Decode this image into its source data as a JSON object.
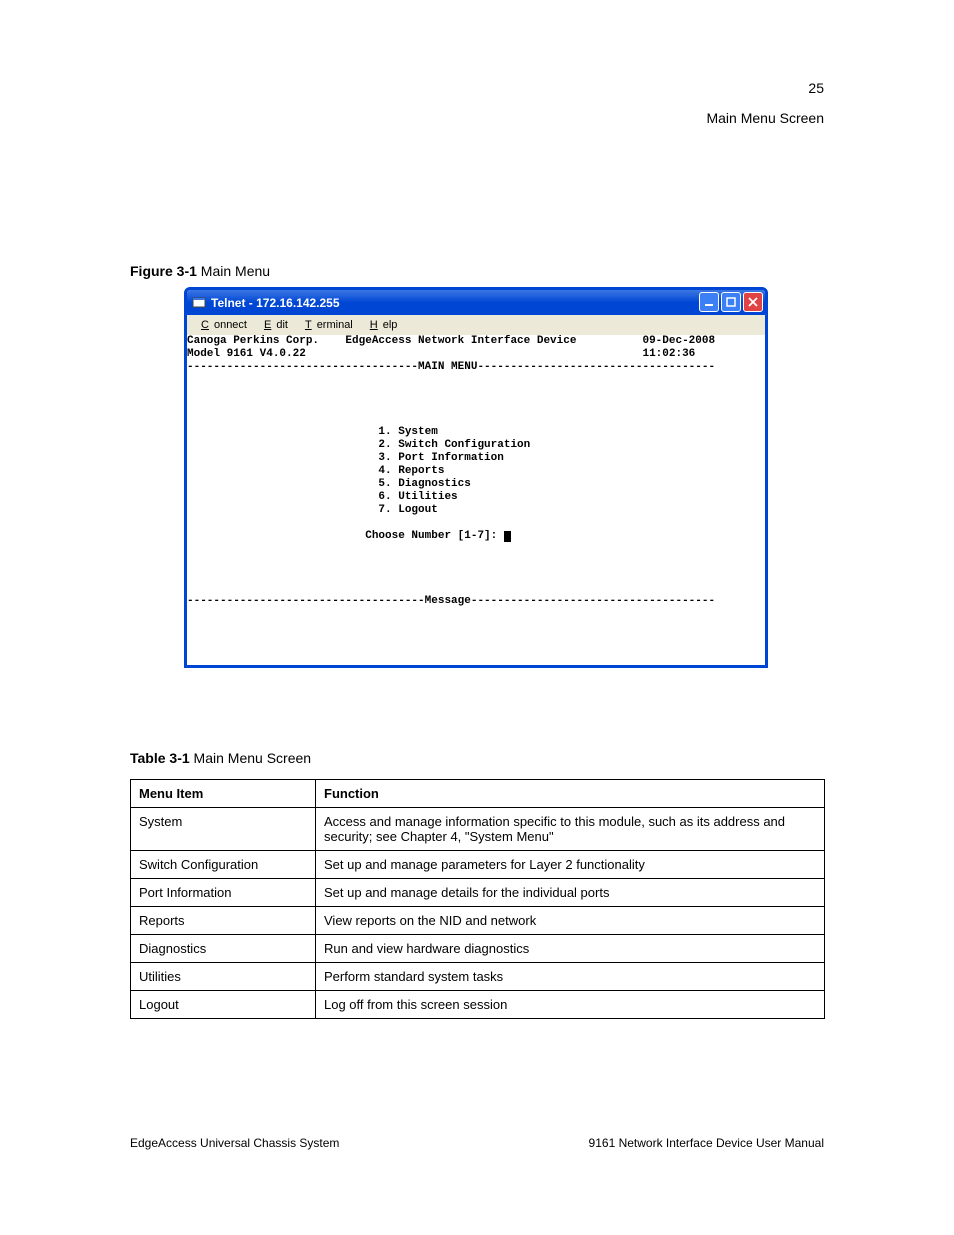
{
  "page": {
    "number": "25",
    "title": "Main Menu Screen"
  },
  "figure": {
    "label": "Figure 3-1",
    "desc": "Main Menu"
  },
  "telnet": {
    "title": "Telnet - 172.16.142.255",
    "menubar": {
      "connect": "Connect",
      "edit": "Edit",
      "terminal": "Terminal",
      "help": "Help"
    },
    "header": {
      "company": "Canoga Perkins Corp.",
      "device": "EdgeAccess Network Interface Device",
      "date": "09-Dec-2008",
      "model": "Model 9161 V4.0.22",
      "time": "11:02:36"
    },
    "main_menu_label": "MAIN MENU",
    "items": [
      "1. System",
      "2. Switch Configuration",
      "3. Port Information",
      "4. Reports",
      "5. Diagnostics",
      "6. Utilities",
      "7. Logout"
    ],
    "prompt": "Choose Number [1-7]: ",
    "message_label": "Message"
  },
  "table": {
    "label": "Table 3-1",
    "desc": "Main Menu Screen",
    "headers": [
      "Menu Item",
      "Function"
    ],
    "rows": [
      [
        "System",
        "Access and manage information specific to this module, such as its address and security; see Chapter 4, \"System Menu\""
      ],
      [
        "Switch Configuration",
        "Set up and manage parameters for Layer 2 functionality"
      ],
      [
        "Port Information",
        "Set up and manage details for the individual ports"
      ],
      [
        "Reports",
        "View reports on the NID and network"
      ],
      [
        "Diagnostics",
        "Run and view hardware diagnostics"
      ],
      [
        "Utilities",
        "Perform standard system tasks"
      ],
      [
        "Logout",
        "Log off from this screen session"
      ]
    ]
  },
  "footer": {
    "left": "EdgeAccess Universal Chassis System",
    "right": "9161 Network Interface Device User Manual"
  }
}
